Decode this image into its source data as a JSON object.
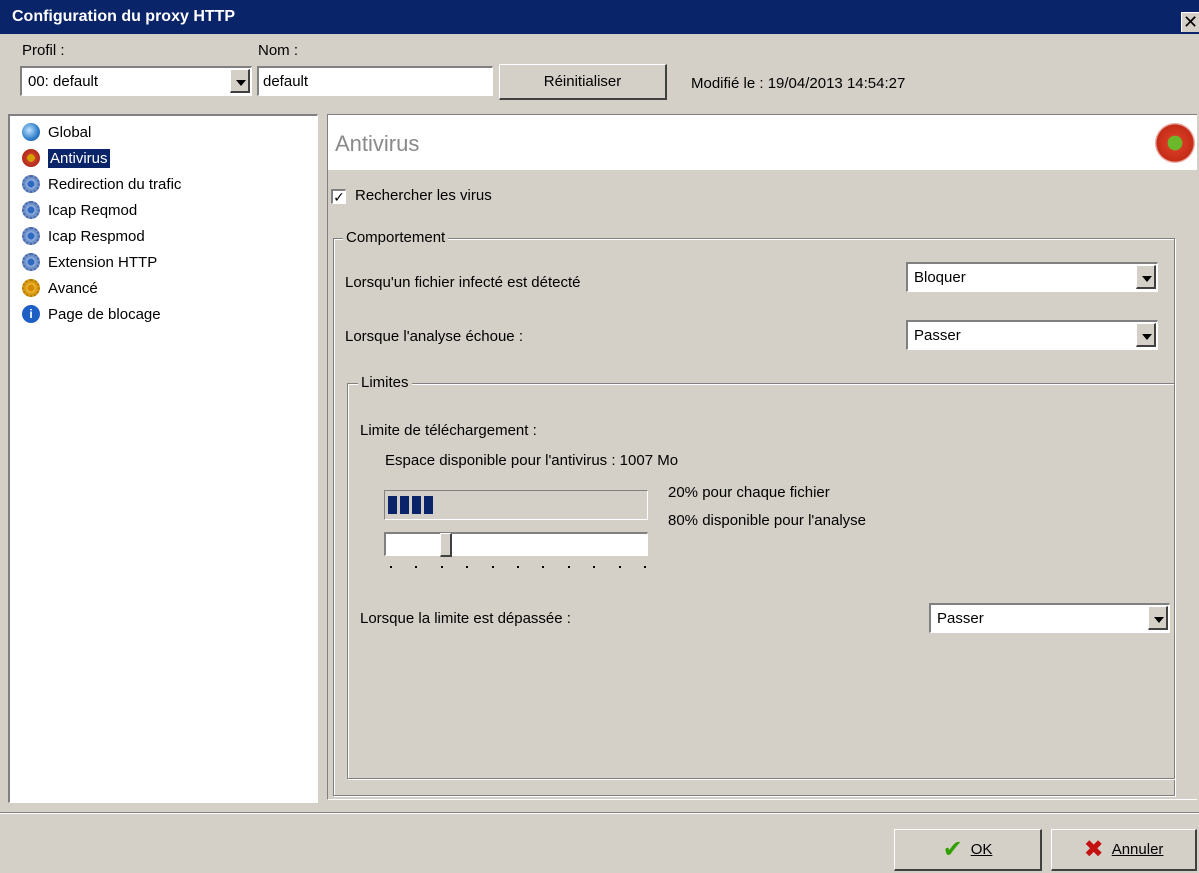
{
  "window": {
    "title": "Configuration du proxy HTTP",
    "close_glyph": "✕"
  },
  "profile": {
    "profil_label": "Profil :",
    "nom_label": "Nom :",
    "selected": "00: default",
    "name_value": "default",
    "reset_label": "Réinitialiser",
    "modified": "Modifié le : 19/04/2013 14:54:27"
  },
  "sidebar": {
    "items": [
      {
        "label": "Global",
        "icon": "globe-icon"
      },
      {
        "label": "Antivirus",
        "icon": "antivirus-icon",
        "selected": true
      },
      {
        "label": "Redirection du trafic",
        "icon": "gear-icon"
      },
      {
        "label": "Icap Reqmod",
        "icon": "gear-icon"
      },
      {
        "label": "Icap Respmod",
        "icon": "gear-icon"
      },
      {
        "label": "Extension HTTP",
        "icon": "gear-icon"
      },
      {
        "label": "Avancé",
        "icon": "gear-icon"
      },
      {
        "label": "Page de blocage",
        "icon": "info-icon"
      }
    ]
  },
  "panel": {
    "title": "Antivirus",
    "scan_label": "Rechercher les virus",
    "scan_checked": true,
    "behavior": {
      "legend": "Comportement",
      "infected_label": "Lorsqu'un fichier infecté est détecté",
      "infected_value": "Bloquer",
      "failure_label": "Lorsque l'analyse échoue :",
      "failure_value": "Passer"
    },
    "limits": {
      "legend": "Limites",
      "download_label": "Limite de téléchargement :",
      "space_label": "Espace disponible pour l'antivirus : 1007 Mo",
      "per_file": "20% pour chaque fichier",
      "available": "80% disponible pour l'analyse",
      "progress_percent": 20,
      "slider_percent": 20,
      "exceeded_label": "Lorsque la limite est dépassée :",
      "exceeded_value": "Passer"
    }
  },
  "footer": {
    "ok_label": "OK",
    "cancel_label": "Annuler"
  },
  "colors": {
    "titlebar": "#0a246a",
    "progress": "#0a246a",
    "ok_check": "#2fa000",
    "cancel_x": "#c41010"
  }
}
